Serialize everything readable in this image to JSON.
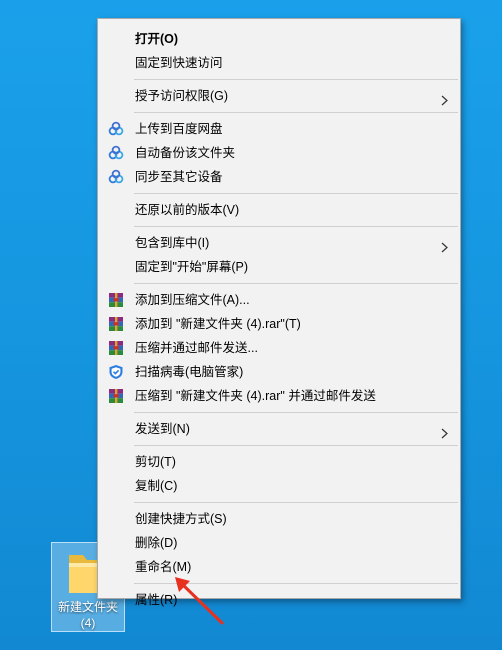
{
  "desktop": {
    "folder": {
      "label_line1": "新建文件夹",
      "label_line2": "(4)",
      "icon": "folder-icon"
    }
  },
  "context_menu": {
    "groups": [
      {
        "items": [
          {
            "label": "打开(O)",
            "bold": true
          },
          {
            "label": "固定到快速访问"
          }
        ]
      },
      {
        "items": [
          {
            "label": "授予访问权限(G)",
            "submenu": true
          }
        ]
      },
      {
        "items": [
          {
            "label": "上传到百度网盘",
            "icon": "baidu-netdisk-icon"
          },
          {
            "label": "自动备份该文件夹",
            "icon": "baidu-netdisk-icon"
          },
          {
            "label": "同步至其它设备",
            "icon": "baidu-netdisk-icon"
          }
        ]
      },
      {
        "items": [
          {
            "label": "还原以前的版本(V)"
          }
        ]
      },
      {
        "items": [
          {
            "label": "包含到库中(I)",
            "submenu": true
          },
          {
            "label": "固定到\"开始\"屏幕(P)"
          }
        ]
      },
      {
        "items": [
          {
            "label": "添加到压缩文件(A)...",
            "icon": "winrar-icon"
          },
          {
            "label": "添加到 \"新建文件夹 (4).rar\"(T)",
            "icon": "winrar-icon"
          },
          {
            "label": "压缩并通过邮件发送...",
            "icon": "winrar-icon"
          },
          {
            "label": "扫描病毒(电脑管家)",
            "icon": "tencent-pc-manager-icon"
          },
          {
            "label": "压缩到 \"新建文件夹 (4).rar\" 并通过邮件发送",
            "icon": "winrar-icon"
          }
        ]
      },
      {
        "items": [
          {
            "label": "发送到(N)",
            "submenu": true
          }
        ]
      },
      {
        "items": [
          {
            "label": "剪切(T)"
          },
          {
            "label": "复制(C)"
          }
        ]
      },
      {
        "items": [
          {
            "label": "创建快捷方式(S)"
          },
          {
            "label": "删除(D)"
          },
          {
            "label": "重命名(M)"
          }
        ]
      },
      {
        "items": [
          {
            "label": "属性(R)"
          }
        ]
      }
    ]
  },
  "annotation": {
    "icon": "red-arrow-icon",
    "color": "#e8301f",
    "points_to": "属性(R)"
  }
}
